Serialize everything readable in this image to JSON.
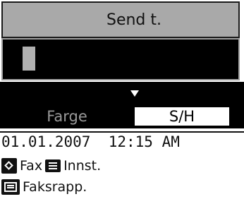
{
  "header": {
    "title": "Send t."
  },
  "entry": {
    "value": ""
  },
  "mode": {
    "left_label": "Farge",
    "right_label": "S/H",
    "selected": "S/H"
  },
  "status": {
    "date": "01.01.2007",
    "time": "12:15 AM"
  },
  "menu": {
    "fax_label": "Fax",
    "settings_label": "Innst.",
    "report_label": "Faksrapp."
  },
  "icons": {
    "start": "diamond-start-icon",
    "menu": "menu-list-icon",
    "report": "fax-report-icon",
    "scroll": "down-arrow-icon"
  }
}
